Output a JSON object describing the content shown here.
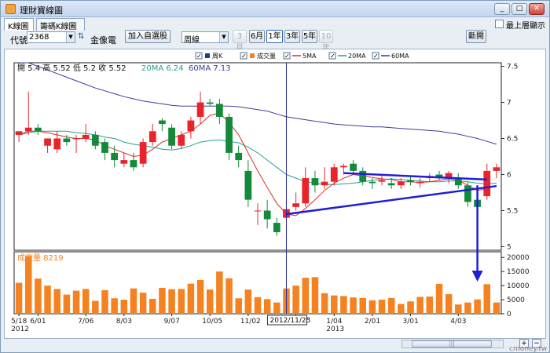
{
  "window": {
    "title": "理財寶線圖",
    "min": "_",
    "max": "□",
    "close": "✕"
  },
  "tabs": [
    {
      "label": "K線圖"
    },
    {
      "label": "籌碼K線圖"
    }
  ],
  "toolbar": {
    "code_label": "代號",
    "code_value": "2368",
    "stock_name": "金像電",
    "add_watch": "加入自選股",
    "period_value": "周線",
    "ranges": [
      "3月",
      "6月",
      "1年",
      "3年",
      "5年",
      "10年"
    ],
    "range_active": "1年",
    "range_disabled": [
      "3月",
      "10年"
    ],
    "link_button": "斷開",
    "topmost_label": "最上層顯示"
  },
  "legend": [
    {
      "label": "周K",
      "color": "#1a3d8f",
      "checked": true
    },
    {
      "label": "成交量",
      "color": "#f58220",
      "checked": true
    },
    {
      "label": "5MA",
      "color": "#d93025",
      "checked": true
    },
    {
      "label": "20MA",
      "color": "#2a9d8f",
      "checked": true
    },
    {
      "label": "60MA",
      "color": "#3b3b9e",
      "checked": true
    }
  ],
  "ohlc_readout": {
    "open_label": "開",
    "open": "5.4",
    "high_label": "高",
    "high": "5.52",
    "low_label": "低",
    "low": "5.2",
    "close_label": "收",
    "close": "5.52",
    "ma20": "20MA 6.24",
    "ma60": "60MA 7.13"
  },
  "volume_readout": "成交量 8219",
  "cursor_date": "2012/11/23",
  "watermark": "cmoney.tw",
  "chart_data": {
    "type": "candlestick",
    "price_axis": {
      "ticks": [
        "7.5",
        "7",
        "6.5",
        "6",
        "5.5",
        "5"
      ],
      "ylim": [
        4.95,
        7.55
      ]
    },
    "volume_axis": {
      "ticks": [
        "20000",
        "15000",
        "10000",
        "5000",
        "0"
      ],
      "ylim": [
        0,
        22000
      ]
    },
    "x_ticks": [
      "5/18",
      "6/01",
      "7/06",
      "8/03",
      "9/07",
      "10/05",
      "11/02",
      "12/07",
      "1/04",
      "2/01",
      "3/01",
      "4/03"
    ],
    "x_tick_years": [
      {
        "tick": "5/18",
        "year": "2012"
      },
      {
        "tick": "1/04",
        "year": "2013"
      }
    ],
    "up_color": "#e8242a",
    "down_color": "#138a3a",
    "candles": [
      {
        "o": 6.55,
        "h": 6.6,
        "l": 6.45,
        "c": 6.6
      },
      {
        "o": 6.6,
        "h": 7.15,
        "l": 6.55,
        "c": 6.65
      },
      {
        "o": 6.65,
        "h": 6.7,
        "l": 6.55,
        "c": 6.6
      },
      {
        "o": 6.4,
        "h": 6.5,
        "l": 6.3,
        "c": 6.5
      },
      {
        "o": 6.35,
        "h": 6.6,
        "l": 6.3,
        "c": 6.5
      },
      {
        "o": 6.5,
        "h": 6.55,
        "l": 6.4,
        "c": 6.45
      },
      {
        "o": 6.5,
        "h": 6.55,
        "l": 6.3,
        "c": 6.5
      },
      {
        "o": 6.5,
        "h": 6.7,
        "l": 6.45,
        "c": 6.55
      },
      {
        "o": 6.55,
        "h": 6.6,
        "l": 6.35,
        "c": 6.4
      },
      {
        "o": 6.45,
        "h": 6.5,
        "l": 6.2,
        "c": 6.3
      },
      {
        "o": 6.3,
        "h": 6.4,
        "l": 6.1,
        "c": 6.2
      },
      {
        "o": 6.15,
        "h": 6.3,
        "l": 6.1,
        "c": 6.2
      },
      {
        "o": 6.2,
        "h": 6.3,
        "l": 6.05,
        "c": 6.1
      },
      {
        "o": 6.15,
        "h": 6.5,
        "l": 6.1,
        "c": 6.45
      },
      {
        "o": 6.45,
        "h": 6.7,
        "l": 6.4,
        "c": 6.6
      },
      {
        "o": 6.75,
        "h": 6.78,
        "l": 6.6,
        "c": 6.7
      },
      {
        "o": 6.65,
        "h": 6.7,
        "l": 6.35,
        "c": 6.4
      },
      {
        "o": 6.4,
        "h": 6.6,
        "l": 6.35,
        "c": 6.55
      },
      {
        "o": 6.6,
        "h": 6.8,
        "l": 6.5,
        "c": 6.75
      },
      {
        "o": 6.8,
        "h": 7.15,
        "l": 6.7,
        "c": 7.0
      },
      {
        "o": 7.0,
        "h": 7.05,
        "l": 6.95,
        "c": 6.98
      },
      {
        "o": 6.98,
        "h": 7.05,
        "l": 6.7,
        "c": 6.8
      },
      {
        "o": 6.8,
        "h": 6.85,
        "l": 6.2,
        "c": 6.3
      },
      {
        "o": 6.3,
        "h": 6.4,
        "l": 6.1,
        "c": 6.2
      },
      {
        "o": 6.05,
        "h": 6.2,
        "l": 5.55,
        "c": 5.65
      },
      {
        "o": 5.5,
        "h": 5.6,
        "l": 5.3,
        "c": 5.5
      },
      {
        "o": 5.5,
        "h": 5.65,
        "l": 5.25,
        "c": 5.38
      },
      {
        "o": 5.33,
        "h": 5.4,
        "l": 5.15,
        "c": 5.2
      },
      {
        "o": 5.4,
        "h": 5.52,
        "l": 5.2,
        "c": 5.52
      },
      {
        "o": 5.55,
        "h": 5.75,
        "l": 5.5,
        "c": 5.6
      },
      {
        "o": 5.6,
        "h": 6.1,
        "l": 5.55,
        "c": 5.95
      },
      {
        "o": 5.95,
        "h": 6.05,
        "l": 5.75,
        "c": 5.85
      },
      {
        "o": 5.85,
        "h": 6.1,
        "l": 5.8,
        "c": 5.9
      },
      {
        "o": 5.9,
        "h": 6.15,
        "l": 5.85,
        "c": 6.1
      },
      {
        "o": 6.1,
        "h": 6.15,
        "l": 6.0,
        "c": 6.12
      },
      {
        "o": 6.15,
        "h": 6.2,
        "l": 6.0,
        "c": 6.05
      },
      {
        "o": 6.05,
        "h": 6.1,
        "l": 5.85,
        "c": 5.9
      },
      {
        "o": 5.9,
        "h": 5.95,
        "l": 5.8,
        "c": 5.88
      },
      {
        "o": 5.9,
        "h": 5.98,
        "l": 5.85,
        "c": 5.92
      },
      {
        "o": 5.88,
        "h": 5.95,
        "l": 5.8,
        "c": 5.85
      },
      {
        "o": 5.85,
        "h": 5.95,
        "l": 5.8,
        "c": 5.9
      },
      {
        "o": 5.92,
        "h": 5.98,
        "l": 5.85,
        "c": 5.9
      },
      {
        "o": 5.88,
        "h": 5.95,
        "l": 5.82,
        "c": 5.9
      },
      {
        "o": 5.95,
        "h": 6.02,
        "l": 5.9,
        "c": 5.98
      },
      {
        "o": 6.0,
        "h": 6.05,
        "l": 5.92,
        "c": 5.95
      },
      {
        "o": 5.95,
        "h": 6.05,
        "l": 5.88,
        "c": 6.02
      },
      {
        "o": 5.95,
        "h": 6.02,
        "l": 5.8,
        "c": 5.85
      },
      {
        "o": 5.85,
        "h": 5.9,
        "l": 5.55,
        "c": 5.62
      },
      {
        "o": 5.65,
        "h": 5.8,
        "l": 5.45,
        "c": 5.55
      },
      {
        "o": 5.7,
        "h": 6.15,
        "l": 5.65,
        "c": 6.05
      },
      {
        "o": 6.05,
        "h": 6.15,
        "l": 5.95,
        "c": 6.1
      }
    ],
    "volume": [
      11000,
      20500,
      12500,
      10000,
      8800,
      6800,
      8200,
      8800,
      4600,
      8400,
      5500,
      5000,
      9000,
      7500,
      5300,
      9200,
      8700,
      8800,
      10700,
      12000,
      8600,
      15000,
      12600,
      5500,
      8600,
      5900,
      5200,
      4000,
      9000,
      10000,
      12800,
      13000,
      7300,
      6500,
      6300,
      5800,
      5600,
      4800,
      5000,
      5600,
      3500,
      4400,
      6000,
      6100,
      10600,
      7000,
      3300,
      4000,
      5100,
      10500,
      4000
    ],
    "ma5": [
      6.55,
      6.6,
      6.6,
      6.58,
      6.55,
      6.52,
      6.5,
      6.5,
      6.48,
      6.4,
      6.35,
      6.3,
      6.25,
      6.27,
      6.35,
      6.45,
      6.5,
      6.55,
      6.6,
      6.7,
      6.82,
      6.85,
      6.72,
      6.55,
      6.3,
      6.05,
      5.82,
      5.6,
      5.45,
      5.43,
      5.53,
      5.65,
      5.78,
      5.88,
      5.95,
      6.0,
      5.98,
      5.96,
      5.94,
      5.93,
      5.9,
      5.9,
      5.89,
      5.9,
      5.92,
      5.94,
      5.92,
      5.85,
      5.78,
      5.8,
      5.85
    ],
    "ma20": [
      6.55,
      6.58,
      6.6,
      6.6,
      6.6,
      6.6,
      6.58,
      6.57,
      6.55,
      6.52,
      6.5,
      6.45,
      6.42,
      6.4,
      6.38,
      6.35,
      6.34,
      6.36,
      6.4,
      6.45,
      6.47,
      6.48,
      6.46,
      6.44,
      6.38,
      6.3,
      6.2,
      6.1,
      6.0,
      5.95,
      5.9,
      5.88,
      5.86,
      5.86,
      5.87,
      5.88,
      5.9,
      5.92,
      5.93,
      5.94,
      5.93,
      5.92,
      5.91,
      5.9,
      5.9,
      5.91,
      5.91,
      5.9,
      5.88,
      5.87,
      5.88
    ],
    "ma60": [
      7.6,
      7.55,
      7.5,
      7.45,
      7.4,
      7.35,
      7.3,
      7.25,
      7.2,
      7.16,
      7.12,
      7.08,
      7.05,
      7.02,
      7.0,
      6.98,
      6.96,
      6.95,
      6.95,
      6.95,
      6.95,
      6.95,
      6.95,
      6.94,
      6.92,
      6.9,
      6.88,
      6.84,
      6.8,
      6.78,
      6.76,
      6.74,
      6.72,
      6.7,
      6.69,
      6.68,
      6.67,
      6.66,
      6.66,
      6.65,
      6.64,
      6.63,
      6.62,
      6.61,
      6.6,
      6.58,
      6.56,
      6.53,
      6.5,
      6.46,
      6.42
    ],
    "cursor_index": 28,
    "trendlines": [
      {
        "from": {
          "i": 28,
          "p": 5.45
        },
        "to": {
          "i": 50,
          "p": 5.84
        },
        "color": "#1f1fd6"
      },
      {
        "from": {
          "i": 34,
          "p": 6.02
        },
        "to": {
          "i": 49,
          "p": 5.93
        },
        "color": "#1f1fd6"
      }
    ],
    "arrow": {
      "i": 48,
      "from_price": 5.85,
      "color": "#1f1fd6"
    }
  }
}
